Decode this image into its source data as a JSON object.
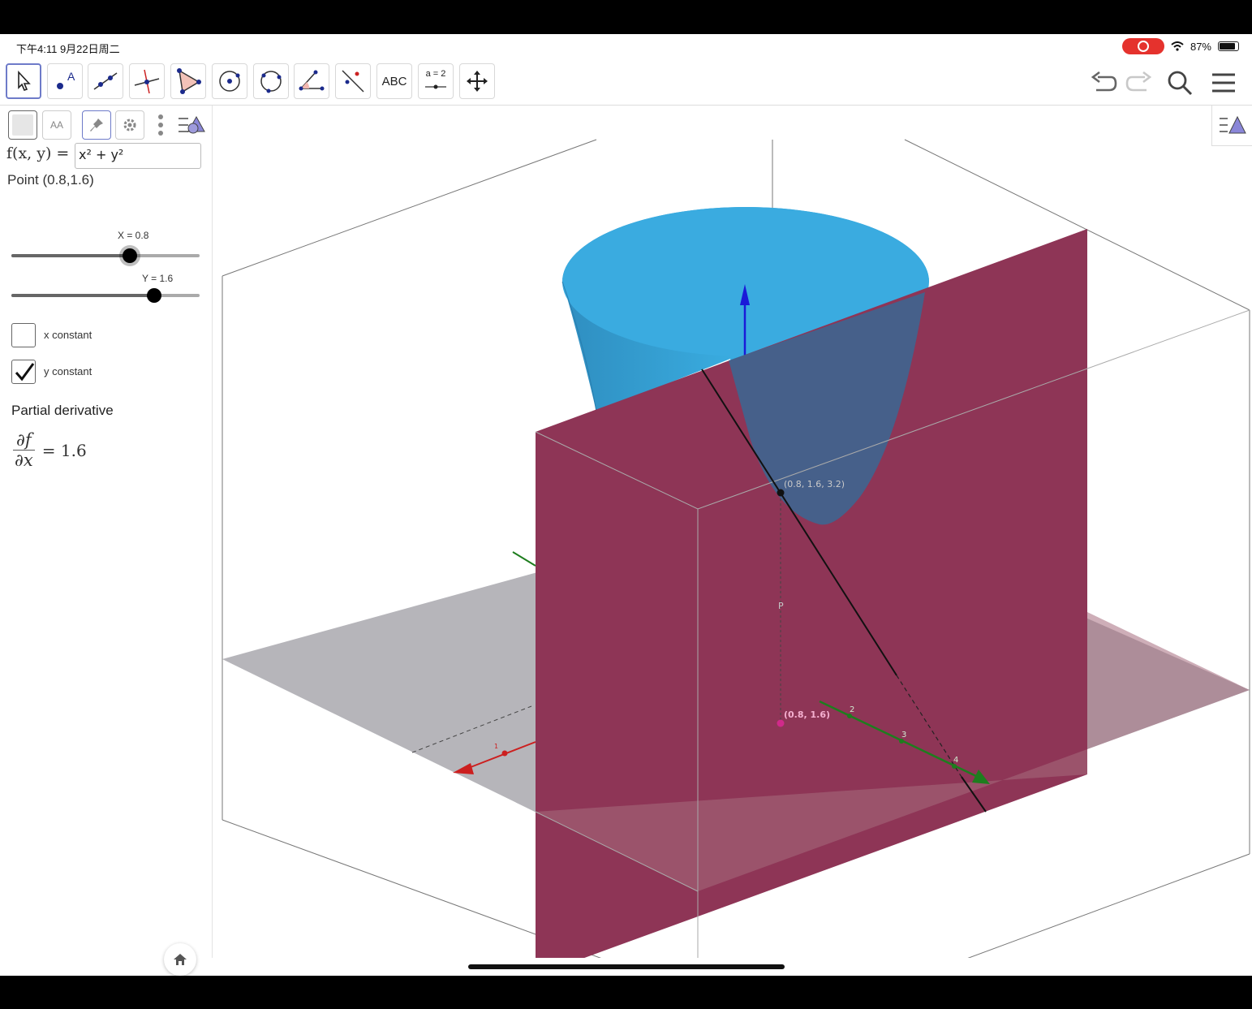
{
  "status_bar": {
    "time": "下午4:11  9月22日周二",
    "battery": "87%",
    "battery_level": 0.87
  },
  "toolbar": {
    "tools": [
      {
        "name": "move-tool",
        "icon": "arrow-cursor-icon"
      },
      {
        "name": "point-tool",
        "icon": "point-icon"
      },
      {
        "name": "line-tool",
        "icon": "line-icon"
      },
      {
        "name": "perpendicular-tool",
        "icon": "perpendicular-icon"
      },
      {
        "name": "polygon-tool",
        "icon": "triangle-icon"
      },
      {
        "name": "circle-tool",
        "icon": "circle-center-icon"
      },
      {
        "name": "circle-3pt-tool",
        "icon": "circle-three-points-icon"
      },
      {
        "name": "angle-tool",
        "icon": "angle-icon"
      },
      {
        "name": "reflect-tool",
        "icon": "reflect-line-icon"
      },
      {
        "name": "text-tool",
        "label": "ABC"
      },
      {
        "name": "slider-tool",
        "label": "a = 2"
      },
      {
        "name": "move-view-tool",
        "icon": "move-arrows-icon"
      }
    ],
    "right_icons": [
      "undo-icon",
      "redo-icon",
      "search-icon",
      "menu-icon"
    ]
  },
  "algebra": {
    "fx_label": "f(x, y) =",
    "fx_value": "x² + y²",
    "point_text": "Point (0.8,1.6)",
    "slider_x": {
      "label": "X = 0.8",
      "value": 0.8,
      "fraction": 0.63
    },
    "slider_y": {
      "label": "Y = 1.6",
      "value": 1.6,
      "fraction": 0.76
    },
    "checkbox_x": {
      "label": "x constant",
      "checked": false
    },
    "checkbox_y": {
      "label": "y constant",
      "checked": true
    },
    "section_title": "Partial derivative",
    "deriv_num": "∂f",
    "deriv_den": "∂x",
    "deriv_value": "= 1.6"
  },
  "view3d": {
    "surface_point_label": "(0.8, 1.6, 3.2)",
    "base_point_label": "(0.8, 1.6)",
    "p_label": "P",
    "axis_ticks": [
      "2",
      "3",
      "4"
    ],
    "x_axis_tick": "1",
    "colors": {
      "surface": "#35a6dc",
      "plane": "#8e3556",
      "floor": "#b4b3b8",
      "y_axis": "#1e7d1e",
      "x_axis": "#cc1f1f",
      "z_axis": "#1a1ad8"
    }
  }
}
